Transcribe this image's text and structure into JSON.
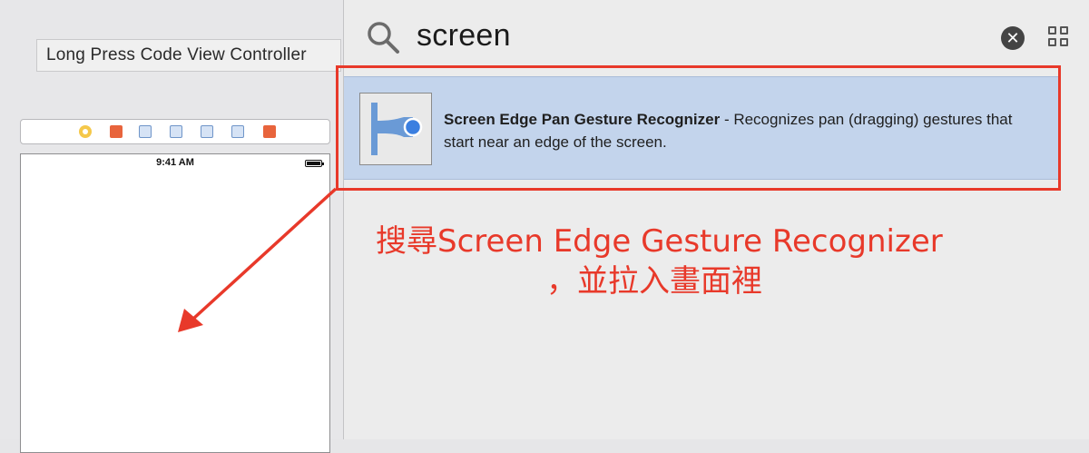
{
  "canvas": {
    "view_controller_title": "Long Press Code View Controller",
    "status_time": "9:41 AM"
  },
  "library": {
    "search_query": "screen",
    "clear_icon_glyph": "✕",
    "result": {
      "title": "Screen Edge Pan Gesture Recognizer",
      "separator": " - ",
      "description": "Recognizes pan (dragging) gestures that start near an edge of the screen."
    }
  },
  "annotation": {
    "line1": "搜尋Screen Edge Gesture Recognizer",
    "line2": "，並拉入畫面裡"
  },
  "colors": {
    "annotation_red": "#e8392a",
    "selection_blue": "#c3d4ec",
    "accent_blue": "#3b82f6"
  }
}
